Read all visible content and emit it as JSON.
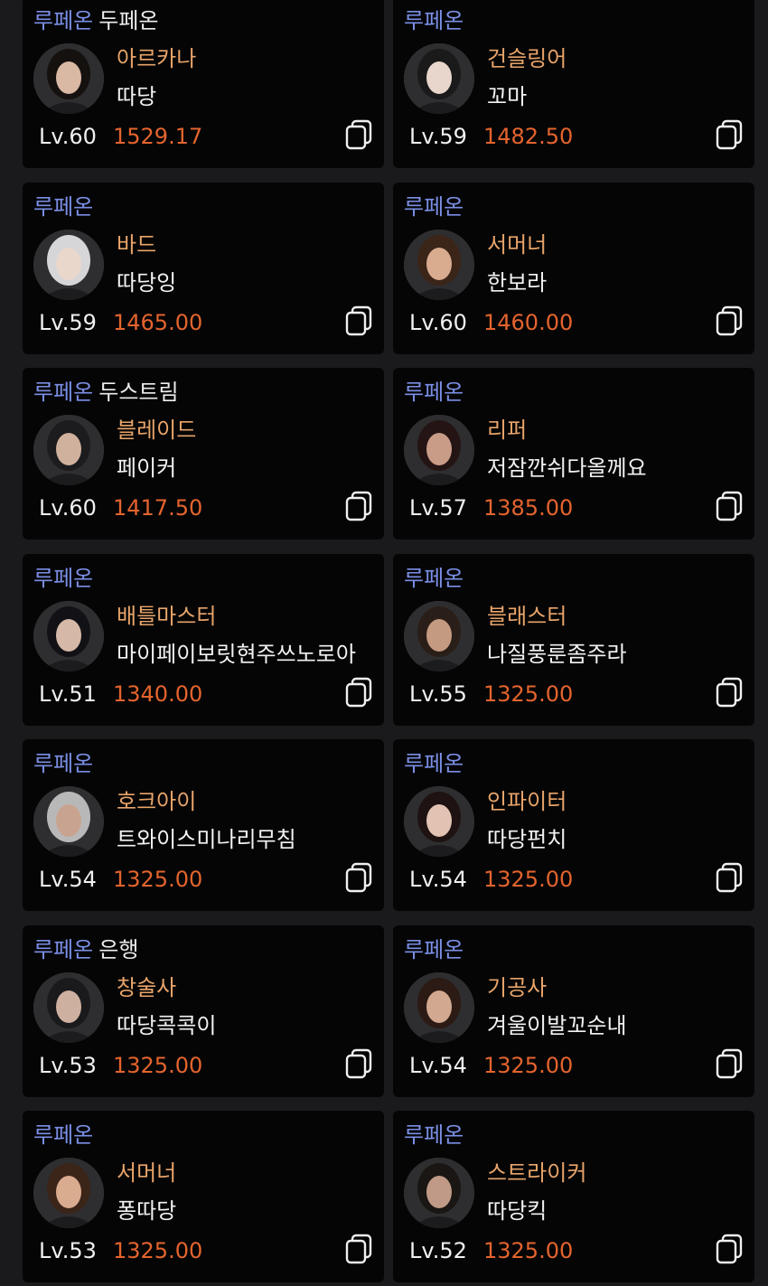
{
  "colors": {
    "background": "#1a1a1d",
    "card": "#050505",
    "server": "#7b8fe6",
    "class": "#e8a46a",
    "item_level": "#e4642e",
    "text": "#f2f2f2"
  },
  "characters": [
    {
      "server": "루페온",
      "guild": "두페온",
      "class": "아르카나",
      "name": "따당",
      "level": "Lv.60",
      "item_level": "1529.17",
      "avatar_hair": "#15110f",
      "avatar_skin": "#d9b8a4"
    },
    {
      "server": "루페온",
      "guild": "",
      "class": "건슬링어",
      "name": "꼬마",
      "level": "Lv.59",
      "item_level": "1482.50",
      "avatar_hair": "#1a1a1a",
      "avatar_skin": "#e8d6cc"
    },
    {
      "server": "루페온",
      "guild": "",
      "class": "바드",
      "name": "따당잉",
      "level": "Lv.59",
      "item_level": "1465.00",
      "avatar_hair": "#d6d6d8",
      "avatar_skin": "#ead7cc"
    },
    {
      "server": "루페온",
      "guild": "",
      "class": "서머너",
      "name": "한보라",
      "level": "Lv.60",
      "item_level": "1460.00",
      "avatar_hair": "#3b2418",
      "avatar_skin": "#d9ab8f"
    },
    {
      "server": "루페온",
      "guild": "두스트림",
      "class": "블레이드",
      "name": "페이커",
      "level": "Lv.60",
      "item_level": "1417.50",
      "avatar_hair": "#1c1c1e",
      "avatar_skin": "#cfb19e"
    },
    {
      "server": "루페온",
      "guild": "",
      "class": "리퍼",
      "name": "저잠깐쉬다올께요",
      "level": "Lv.57",
      "item_level": "1385.00",
      "avatar_hair": "#241414",
      "avatar_skin": "#c99c88"
    },
    {
      "server": "루페온",
      "guild": "",
      "class": "배틀마스터",
      "name": "마이페이보릿현주쓰노로아",
      "level": "Lv.51",
      "item_level": "1340.00",
      "avatar_hair": "#121216",
      "avatar_skin": "#d5b8a8"
    },
    {
      "server": "루페온",
      "guild": "",
      "class": "블래스터",
      "name": "나질풍룬좀주라",
      "level": "Lv.55",
      "item_level": "1325.00",
      "avatar_hair": "#2a1e18",
      "avatar_skin": "#c49a80"
    },
    {
      "server": "루페온",
      "guild": "",
      "class": "호크아이",
      "name": "트와이스미나리무침",
      "level": "Lv.54",
      "item_level": "1325.00",
      "avatar_hair": "#b8b8b8",
      "avatar_skin": "#c8a490"
    },
    {
      "server": "루페온",
      "guild": "",
      "class": "인파이터",
      "name": "따당펀치",
      "level": "Lv.54",
      "item_level": "1325.00",
      "avatar_hair": "#1e1212",
      "avatar_skin": "#e2c2b2"
    },
    {
      "server": "루페온",
      "guild": "은행",
      "class": "창술사",
      "name": "따당콕콕이",
      "level": "Lv.53",
      "item_level": "1325.00",
      "avatar_hair": "#1a1a1c",
      "avatar_skin": "#cdb0a0"
    },
    {
      "server": "루페온",
      "guild": "",
      "class": "기공사",
      "name": "겨울이발꼬순내",
      "level": "Lv.54",
      "item_level": "1325.00",
      "avatar_hair": "#2c1a14",
      "avatar_skin": "#d2a890"
    },
    {
      "server": "루페온",
      "guild": "",
      "class": "서머너",
      "name": "퐁따당",
      "level": "Lv.53",
      "item_level": "1325.00",
      "avatar_hair": "#3b2418",
      "avatar_skin": "#d9ab8f"
    },
    {
      "server": "루페온",
      "guild": "",
      "class": "스트라이커",
      "name": "따당킥",
      "level": "Lv.52",
      "item_level": "1325.00",
      "avatar_hair": "#1a1614",
      "avatar_skin": "#c09a86"
    }
  ]
}
